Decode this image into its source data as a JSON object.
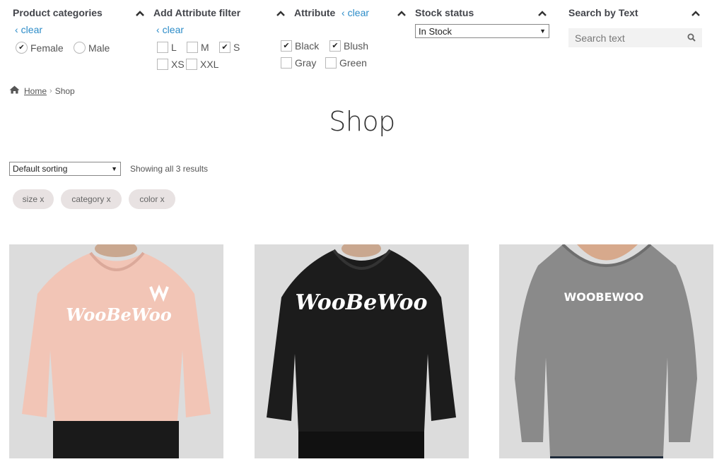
{
  "filters": {
    "categories": {
      "title": "Product categories",
      "clear_label": "clear",
      "options": [
        {
          "label": "Female",
          "checked": true
        },
        {
          "label": "Male",
          "checked": false
        }
      ]
    },
    "add_attribute": {
      "title": "Add Attribute filter",
      "clear_label": "clear",
      "options": [
        {
          "label": "L",
          "checked": false
        },
        {
          "label": "M",
          "checked": false
        },
        {
          "label": "S",
          "checked": true
        },
        {
          "label": "XS",
          "checked": false
        },
        {
          "label": "XXL",
          "checked": false
        }
      ]
    },
    "attribute": {
      "title": "Attribute",
      "clear_label": "clear",
      "options": [
        {
          "label": "Black",
          "checked": true
        },
        {
          "label": "Blush",
          "checked": true
        },
        {
          "label": "Gray",
          "checked": false
        },
        {
          "label": "Green",
          "checked": false
        }
      ]
    },
    "stock": {
      "title": "Stock status",
      "selected": "In Stock"
    },
    "search": {
      "title": "Search by Text",
      "placeholder": "Search text"
    }
  },
  "breadcrumb": {
    "home": "Home",
    "current": "Shop"
  },
  "page_title": "Shop",
  "sorting": {
    "selected": "Default sorting"
  },
  "result_count": "Showing all 3 results",
  "active_filters": [
    "size x",
    "category x",
    "color x"
  ],
  "products": [
    {
      "logo_text": "WooBeWoo",
      "color": "#f2c5b6",
      "icon": "pink-hoodie-image"
    },
    {
      "logo_text": "WooBeWoo",
      "color": "#1c1c1c",
      "icon": "black-hoodie-image"
    },
    {
      "logo_text": "WOOBEWOO",
      "color": "#8a8a8a",
      "icon": "gray-sweatshirt-image"
    }
  ],
  "colors": {
    "link": "#2c8cc8",
    "chip_bg": "#e8e2e2",
    "product_bg": "#dcdcdc"
  }
}
